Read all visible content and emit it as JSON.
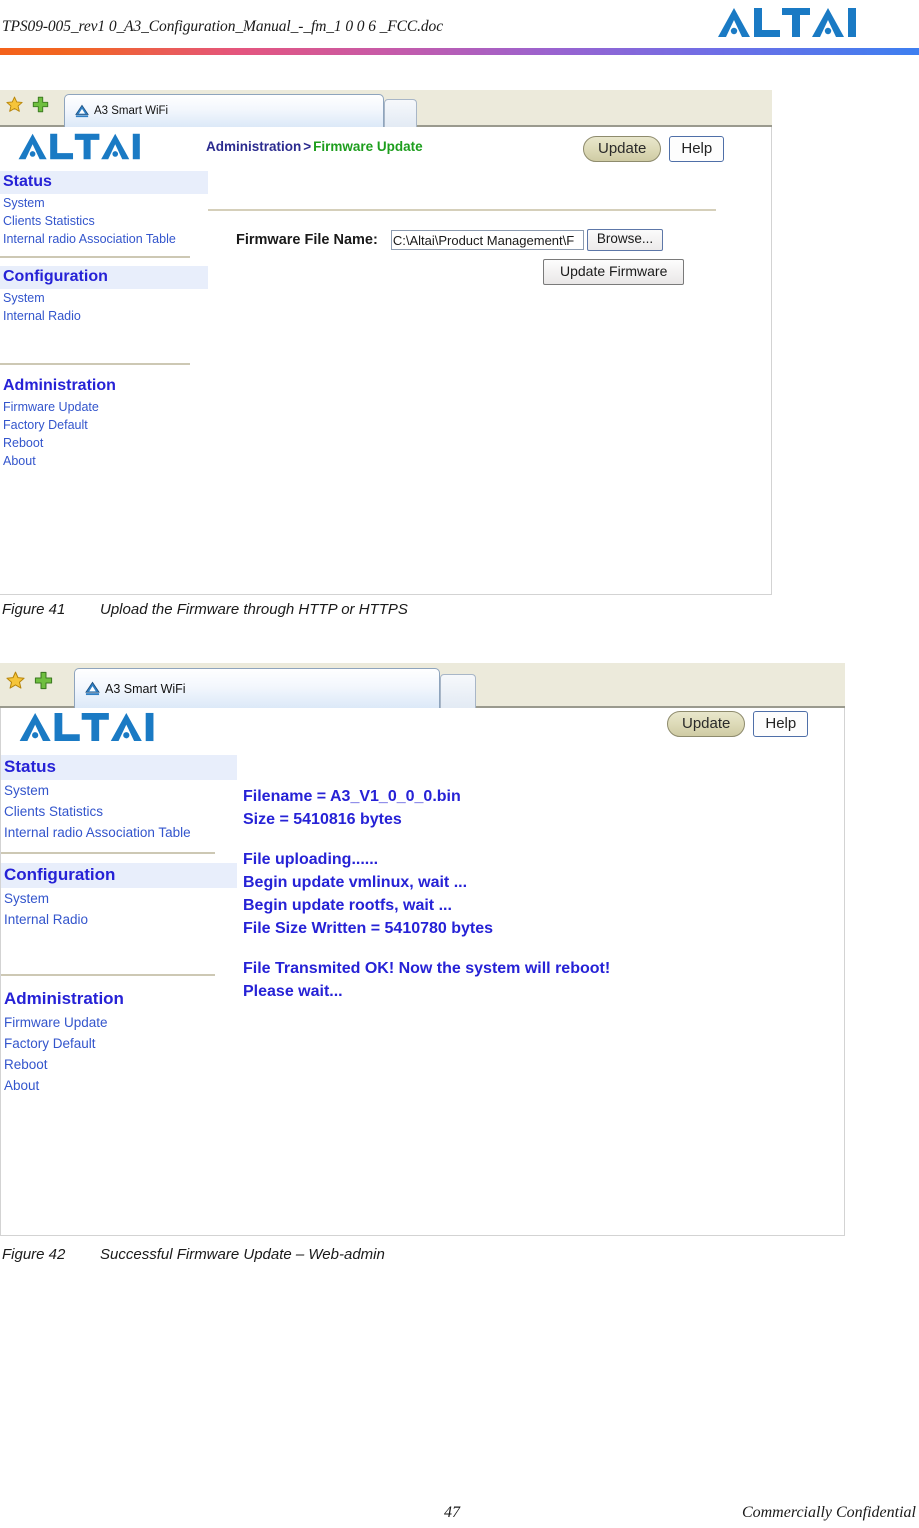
{
  "document": {
    "header_title": "TPS09-005_rev1 0_A3_Configuration_Manual_-_fm_1 0 0 6 _FCC.doc",
    "brand": "ALTAI",
    "footer_page_number": "47",
    "footer_note": "Commercially Confidential"
  },
  "colors": {
    "brand_blue": "#1a7ac4",
    "sidebar_heading": "#2622d6",
    "sidebar_link": "#3355cc",
    "breadcrumb_root": "#2b2b8f",
    "breadcrumb_leaf": "#1d9e1d",
    "log_text": "#2622d6",
    "rule_tan": "#cdc8b4",
    "chrome_bg": "#eceadb",
    "update_button": "#dcd9b6"
  },
  "figure_1": {
    "caption_number": "Figure 41",
    "caption_text": "Upload the Firmware through HTTP or HTTPS",
    "browser": {
      "tab_label": "A3 Smart WiFi",
      "favicon_name": "altai-triangle-favicon",
      "star_icon": "favorites-star-icon",
      "plus_icon": "add-favorite-plus-icon"
    },
    "app": {
      "logo": "ALTAI",
      "breadcrumb": {
        "root": "Administration",
        "separator": ">",
        "leaf": "Firmware Update"
      },
      "buttons": {
        "update": "Update",
        "help": "Help"
      },
      "sidebar": [
        {
          "heading": "Status",
          "items": [
            "System",
            "Clients Statistics",
            "Internal radio Association Table"
          ]
        },
        {
          "heading": "Configuration",
          "items": [
            "System",
            "Internal Radio"
          ]
        },
        {
          "heading": "Administration",
          "items": [
            "Firmware Update",
            "Factory Default",
            "Reboot",
            "About"
          ]
        }
      ],
      "form": {
        "file_label": "Firmware File Name:",
        "file_value": "C:\\Altai\\Product Management\\F",
        "browse_label": "Browse...",
        "submit_label": "Update Firmware"
      }
    }
  },
  "figure_2": {
    "caption_number": "Figure 42",
    "caption_text": "Successful Firmware Update – Web-admin",
    "browser": {
      "tab_label": "A3 Smart WiFi",
      "favicon_name": "altai-triangle-favicon",
      "star_icon": "favorites-star-icon",
      "plus_icon": "add-favorite-plus-icon"
    },
    "app": {
      "logo": "ALTAI",
      "buttons": {
        "update": "Update",
        "help": "Help"
      },
      "sidebar": [
        {
          "heading": "Status",
          "items": [
            "System",
            "Clients Statistics",
            "Internal radio Association Table"
          ]
        },
        {
          "heading": "Configuration",
          "items": [
            "System",
            "Internal Radio"
          ]
        },
        {
          "heading": "Administration",
          "items": [
            "Firmware Update",
            "Factory Default",
            "Reboot",
            "About"
          ]
        }
      ],
      "log": {
        "filename_line": "Filename = A3_V1_0_0_0.bin",
        "size_line": "Size = 5410816 bytes",
        "uploading_line": "File uploading......",
        "vmlinux_line": "Begin update vmlinux, wait ...",
        "rootfs_line": "Begin update rootfs, wait ...",
        "written_line": "File Size Written = 5410780 bytes",
        "transmitted_line": "File Transmited OK! Now the system will reboot!",
        "wait_line": "Please wait..."
      }
    }
  }
}
